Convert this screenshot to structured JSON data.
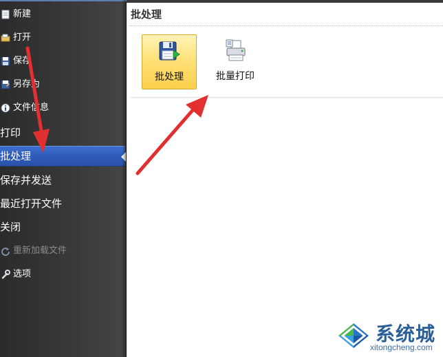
{
  "colors": {
    "sidebar_bg": "#3a3a3a",
    "selected_bg": "#2f5bb8",
    "active_button_bg": "#ffe27a",
    "arrow": "#e23030",
    "watermark": "#2a5f9a"
  },
  "sidebar": {
    "items": [
      {
        "label": "新建",
        "icon": "new-doc-icon"
      },
      {
        "label": "打开",
        "icon": "open-folder-icon"
      },
      {
        "label": "保存",
        "icon": "save-disk-icon"
      },
      {
        "label": "另存为",
        "icon": "save-as-icon"
      },
      {
        "label": "文件信息",
        "icon": "info-icon"
      },
      {
        "label": "打印"
      },
      {
        "label": "批处理",
        "selected": true
      },
      {
        "label": "保存并发送"
      },
      {
        "label": "最近打开文件"
      },
      {
        "label": "关闭"
      },
      {
        "label": "重新加载文件",
        "icon": "reload-icon",
        "disabled": true
      },
      {
        "label": "选项",
        "icon": "wrench-icon"
      }
    ]
  },
  "main": {
    "title": "批处理",
    "buttons": [
      {
        "label": "批处理",
        "icon": "batch-save-icon",
        "active": true
      },
      {
        "label": "批量打印",
        "icon": "batch-print-icon"
      }
    ]
  },
  "watermark": {
    "brand": "系统城",
    "site": "xitongcheng.com",
    "icon": "diamond-logo-icon"
  }
}
